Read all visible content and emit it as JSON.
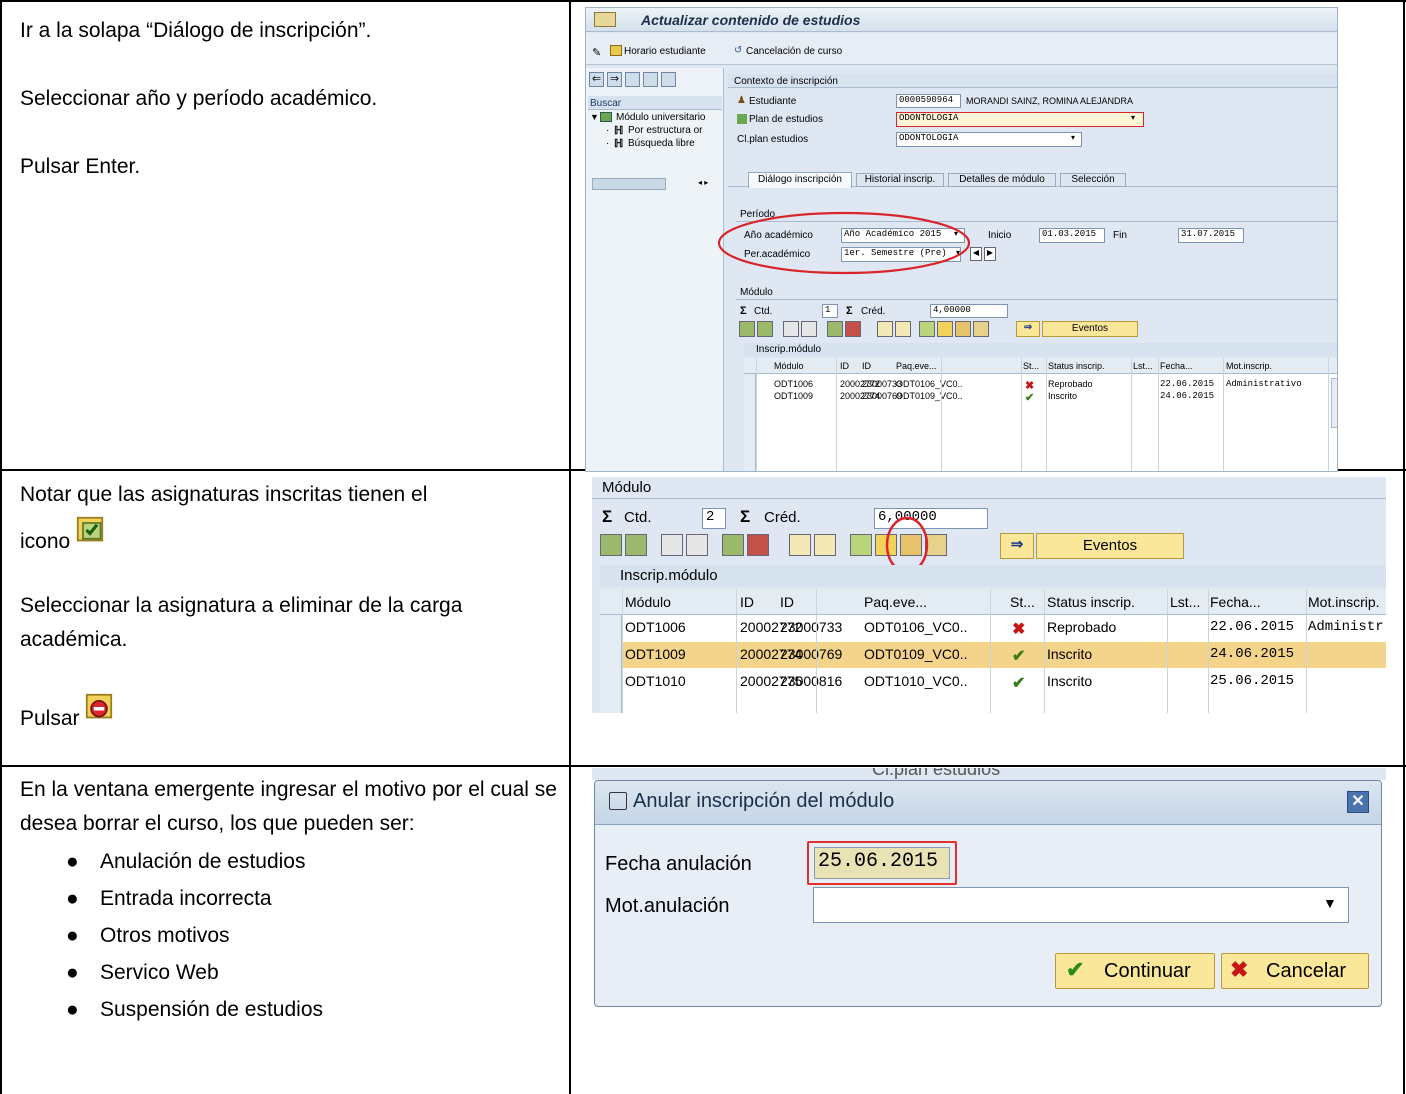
{
  "left_text": {
    "row1": [
      "Ir a la solapa “Diálogo de inscripción”.",
      "Seleccionar año y período académico.",
      "Pulsar Enter."
    ],
    "row2": {
      "note1": "Notar que las asignaturas inscritas tienen el",
      "note1_b": "icono",
      "select": "Seleccionar la asignatura a eliminar de la carga académica.",
      "press": "Pulsar"
    },
    "row3": {
      "intro": "En la ventana emergente ingresar el motivo por el cual se desea borrar el curso, los que pueden ser:",
      "bullets": [
        "Anulación de estudios",
        "Entrada incorrecta",
        "Otros motivos",
        "Servico Web",
        "Suspensión de estudios"
      ]
    }
  },
  "shot1": {
    "title": "Actualizar contenido de estudios",
    "toolbar": [
      "Horario estudiante",
      "Cancelación de curso"
    ],
    "search": "Buscar",
    "tree": [
      "Módulo universitario",
      "Por estructura or",
      "Búsqueda libre"
    ],
    "context_title": "Contexto de inscripción",
    "context_labels": [
      "Estudiante",
      "Plan de estudios",
      "Cl.plan estudios"
    ],
    "student_id": "0000590964",
    "student_name": "MORANDI SAINZ, ROMINA ALEJANDRA",
    "plan": "ODONTOLOGIA",
    "cl_plan": "ODONTOLOGÍA",
    "tabs": [
      "Diálogo inscripción",
      "Historial inscrip.",
      "Detalles de módulo",
      "Selección"
    ],
    "period_title": "Período",
    "year_label": "Año académico",
    "year_value": "Año Académico 2015",
    "per_label": "Per.académico",
    "per_value": "1er. Semestre (Pre)",
    "inicio_label": "Inicio",
    "inicio": "01.03.2015",
    "fin_label": "Fin",
    "fin": "31.07.2015",
    "modulo_title": "Módulo",
    "ctd_label": "Ctd.",
    "ctd": "1",
    "cred_label": "Créd.",
    "cred": "4,00000",
    "eventos": "Eventos",
    "table_title": "Inscrip.módulo",
    "headers": [
      "Módulo",
      "ID",
      "ID",
      "Paq.eve...",
      "St...",
      "Status inscrip.",
      "Lst...",
      "Fecha...",
      "Mot.inscrip."
    ],
    "rows": [
      [
        "ODT1006",
        "20002772",
        "23000733",
        "ODT0106_VC0..",
        "",
        "Reprobado",
        "",
        "22.06.2015",
        "Administrativo"
      ],
      [
        "ODT1009",
        "20002774",
        "23000769",
        "ODT0109_VC0..",
        "",
        "Inscrito",
        "",
        "24.06.2015",
        ""
      ]
    ]
  },
  "shot2": {
    "modulo_title": "Módulo",
    "ctd_label": "Ctd.",
    "ctd": "2",
    "cred_label": "Créd.",
    "cred": "6,00000",
    "eventos": "Eventos",
    "table_title": "Inscrip.módulo",
    "headers": [
      "Módulo",
      "ID",
      "ID",
      "Paq.eve...",
      "St...",
      "Status inscrip.",
      "Lst...",
      "Fecha...",
      "Mot.inscrip."
    ],
    "rows": [
      [
        "ODT1006",
        "20002772",
        "23000733",
        "ODT0106_VC0..",
        "",
        "Reprobado",
        "",
        "22.06.2015",
        "Administr"
      ],
      [
        "ODT1009",
        "20002774",
        "23000769",
        "ODT0109_VC0..",
        "",
        "Inscrito",
        "",
        "24.06.2015",
        ""
      ],
      [
        "ODT1010",
        "20002775",
        "23000816",
        "ODT1010_VC0..",
        "",
        "Inscrito",
        "",
        "25.06.2015",
        ""
      ]
    ]
  },
  "shot3": {
    "bg_text": "Cl.plan estudios",
    "title": "Anular inscripción del módulo",
    "fecha_label": "Fecha anulación",
    "fecha": "25.06.2015",
    "motivo_label": "Mot.anulación",
    "motivo": "",
    "continuar": "Continuar",
    "cancelar": "Cancelar"
  },
  "colors": {
    "sap_bg": "#dfe8f2",
    "selected_row": "#f4d38a",
    "button_yellow": "#fbe79a",
    "red_circle": "#d9242b"
  }
}
